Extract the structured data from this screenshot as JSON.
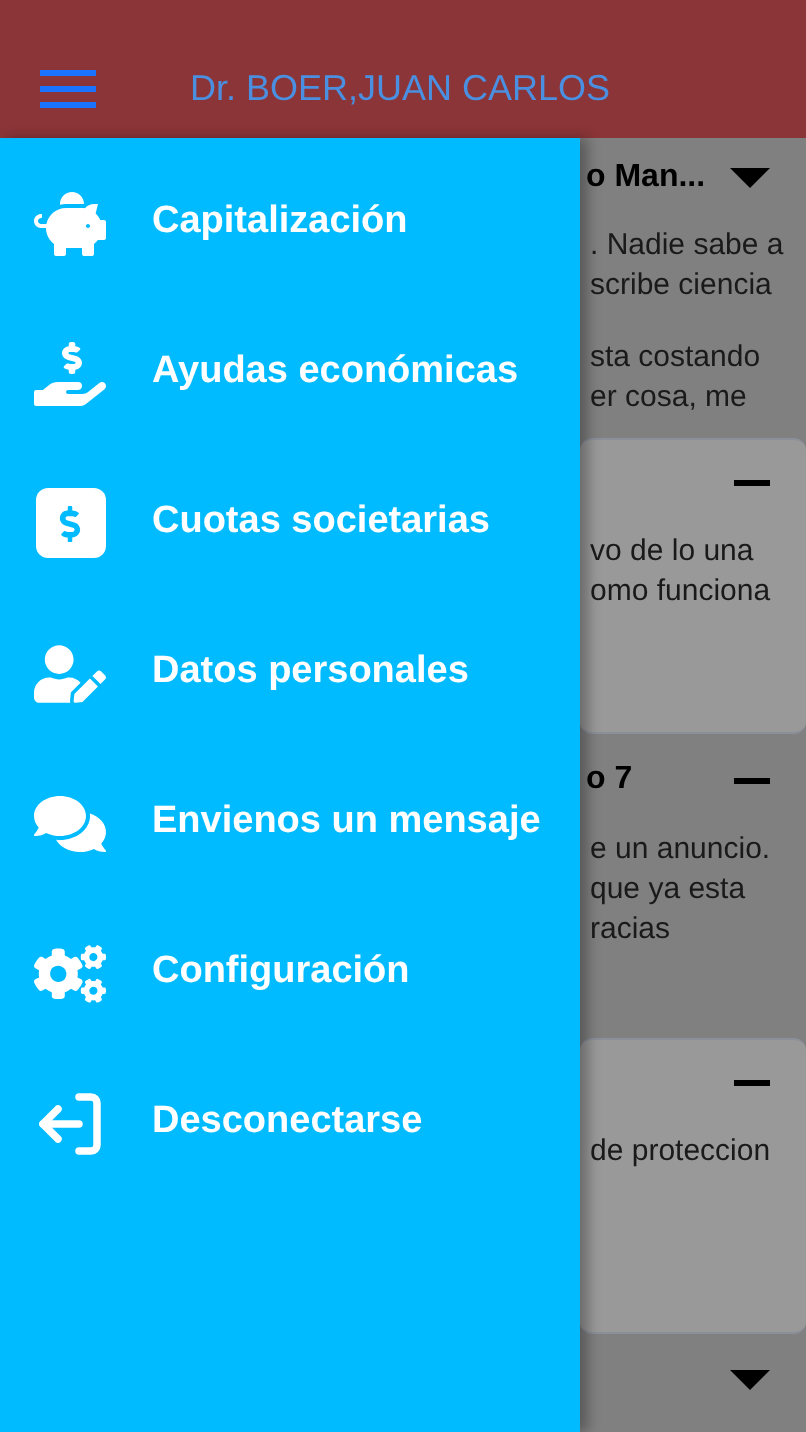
{
  "header": {
    "title": "Dr. BOER,JUAN CARLOS"
  },
  "menu": [
    {
      "label": "Capitalización"
    },
    {
      "label": "Ayudas económicas"
    },
    {
      "label": "Cuotas societarias"
    },
    {
      "label": "Datos personales"
    },
    {
      "label": "Envienos un mensaje"
    },
    {
      "label": "Configuración"
    },
    {
      "label": "Desconectarse"
    }
  ],
  "cards": [
    {
      "title": "o Man...",
      "expanded": false,
      "kind": "dark",
      "paragraphs": [
        [
          ". Nadie sabe a",
          "scribe ciencia"
        ],
        [
          "sta costando",
          "er cosa, me"
        ]
      ]
    },
    {
      "expanded": true,
      "kind": "light",
      "paragraphs": [
        [
          "vo de lo una",
          "omo funciona"
        ]
      ]
    },
    {
      "title": "o 7",
      "expanded": true,
      "kind": "dark",
      "paragraphs": [
        [
          "e un anuncio.",
          "que ya esta",
          "racias"
        ]
      ]
    },
    {
      "expanded": true,
      "kind": "light",
      "paragraphs": [
        [
          "de proteccion"
        ]
      ]
    },
    {
      "expanded": false,
      "kind": "dark"
    }
  ]
}
